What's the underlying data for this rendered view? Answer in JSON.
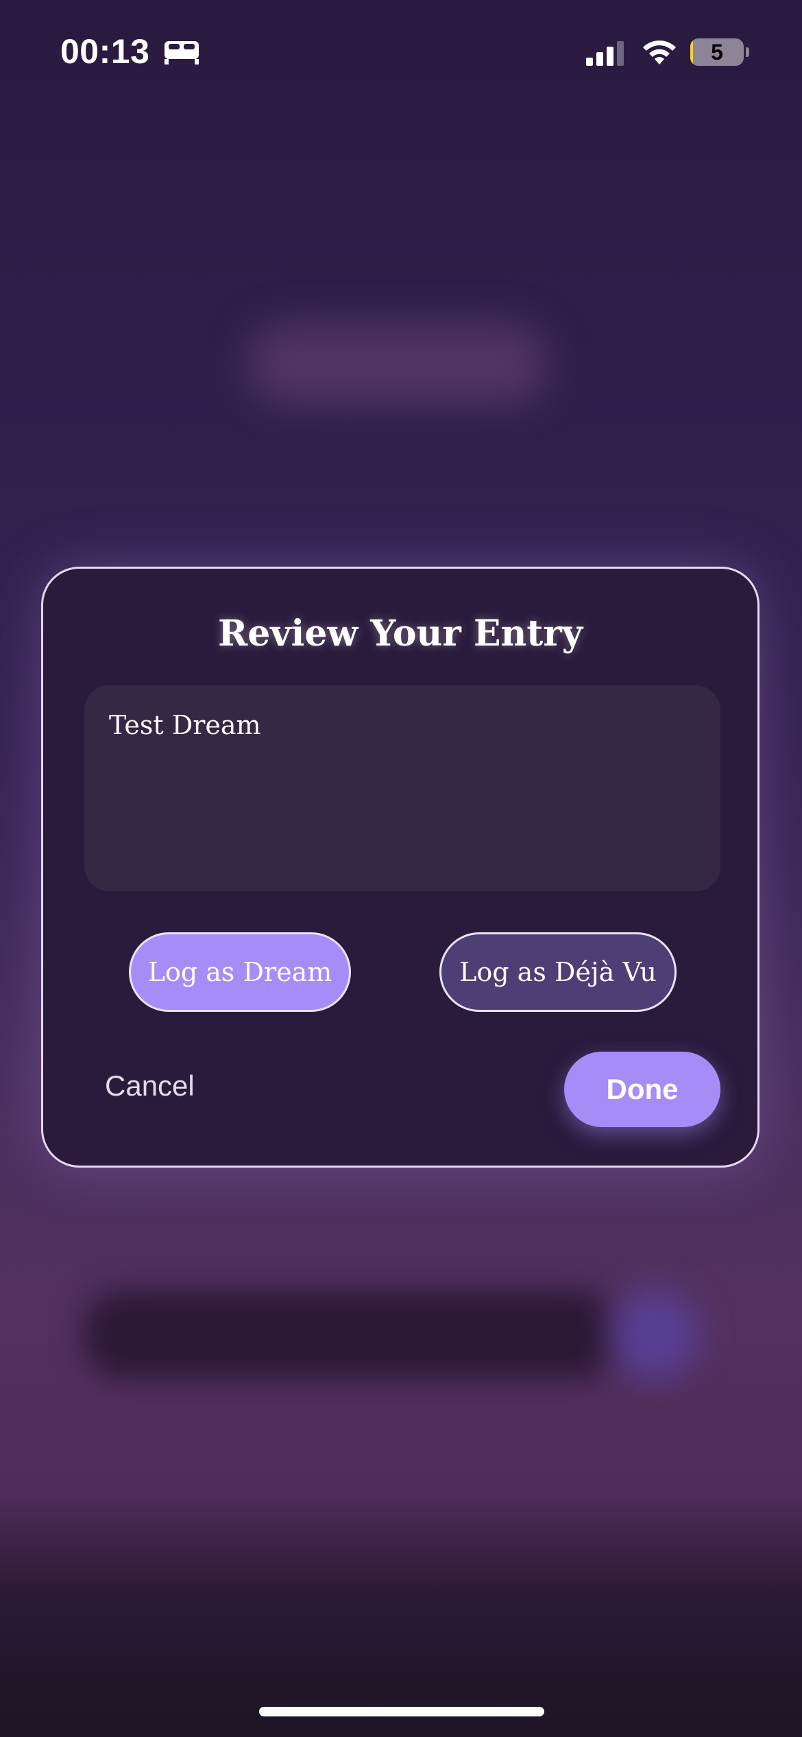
{
  "status_bar": {
    "time": "00:13",
    "battery_level": "5",
    "battery_fraction": 0.05,
    "icons": [
      "sleep-bed-icon",
      "cellular-signal-icon",
      "wifi-icon",
      "battery-icon"
    ]
  },
  "modal": {
    "title": "Review Your Entry",
    "entry_text": "Test Dream",
    "log_dream_label": "Log as Dream",
    "log_deja_vu_label": "Log as Déjà Vu",
    "cancel_label": "Cancel",
    "done_label": "Done"
  },
  "colors": {
    "accent": "#a68cf7",
    "secondary_button": "#4d3f75",
    "modal_background": "#2a1a3c",
    "modal_border": "#e8d6f2"
  }
}
